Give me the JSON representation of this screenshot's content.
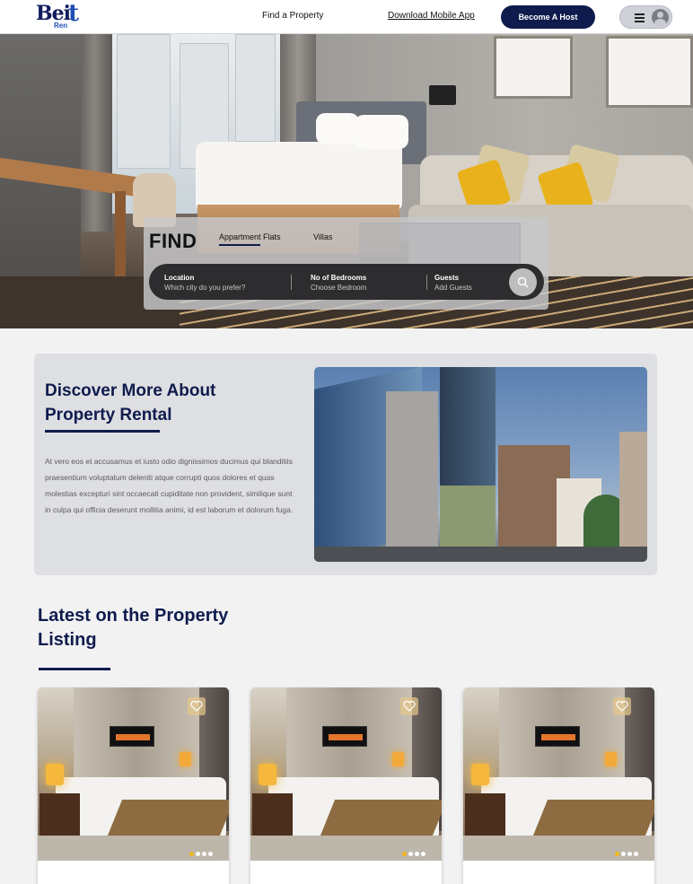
{
  "brand": {
    "logo_main": "Bei",
    "logo_accent": "t",
    "logo_sub": "Ren"
  },
  "nav": {
    "find_property": "Find a Property",
    "download_app": "Download Mobile App",
    "become_host": "Become A Host"
  },
  "search": {
    "title": "FIND",
    "tabs": [
      {
        "label": "Appartment Flats",
        "active": true
      },
      {
        "label": "Villas",
        "active": false
      }
    ],
    "fields": [
      {
        "label": "Location",
        "placeholder": "Which city do you prefer?"
      },
      {
        "label": "No of Bedrooms",
        "placeholder": "Choose Bedroom"
      },
      {
        "label": "Guests",
        "placeholder": "Add Guests"
      }
    ]
  },
  "about": {
    "title": "Discover More About Property Rental",
    "body": "At vero eos et accusamus et iusto odio dignissimos ducimus qui blanditiis praesentium voluptatum deleniti atque corrupti quos dolores et quas molestias excepturi sint occaecati cupiditate non provident, similique sunt in culpa qui officia deserunt mollitia animi, id est laborum et dolorum fuga."
  },
  "listing": {
    "title": "Latest on the Property Listing",
    "cards": [
      {
        "active_slide": 1,
        "slides": 4
      },
      {
        "active_slide": 1,
        "slides": 4
      },
      {
        "active_slide": 1,
        "slides": 4
      }
    ]
  },
  "colors": {
    "navy": "#0f1b4d",
    "accent": "#f2b81e",
    "logo_blue": "#1f4fb4"
  }
}
